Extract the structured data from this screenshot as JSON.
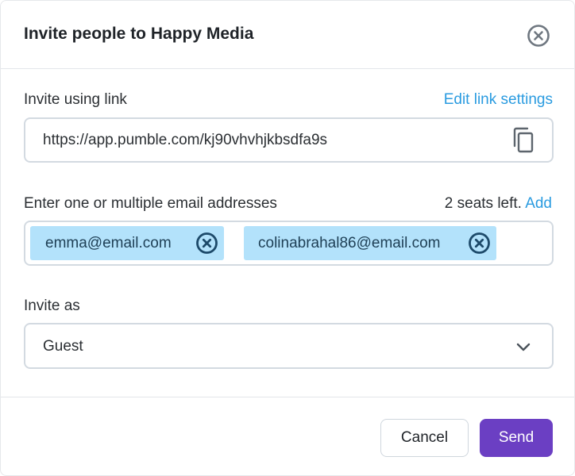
{
  "dialog": {
    "title": "Invite people to Happy Media",
    "close_icon": "close-circle-icon"
  },
  "link_section": {
    "label": "Invite using link",
    "edit_link": "Edit link settings",
    "url": "https://app.pumble.com/kj90vhvhjkbsdfa9s",
    "copy_icon": "copy-icon"
  },
  "email_section": {
    "label": "Enter one or multiple email addresses",
    "seats_text": "2 seats left.",
    "add_link": "Add",
    "chips": [
      {
        "email": "emma@email.com",
        "remove_icon": "remove-circle-icon"
      },
      {
        "email": "colinabrahal86@email.com",
        "remove_icon": "remove-circle-icon"
      }
    ]
  },
  "role_section": {
    "label": "Invite as",
    "selected": "Guest",
    "chevron_icon": "chevron-down-icon"
  },
  "footer": {
    "cancel_label": "Cancel",
    "send_label": "Send"
  },
  "colors": {
    "accent_link": "#2a9be0",
    "chip_background": "#b3e2fb",
    "send_button": "#6b3fc3",
    "field_border": "#d3dae1"
  }
}
